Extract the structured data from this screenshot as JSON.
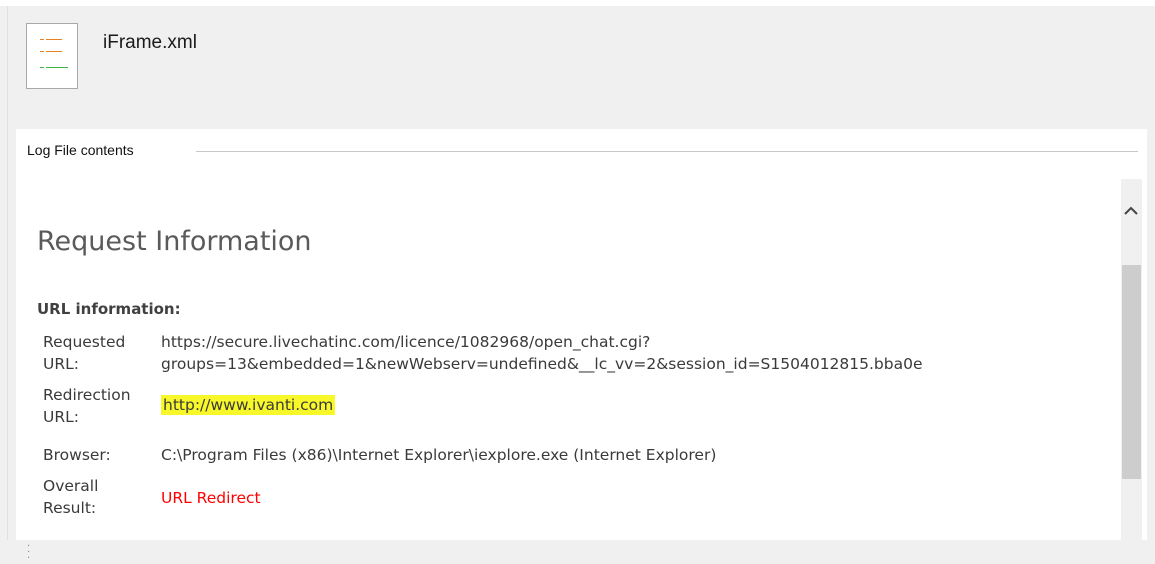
{
  "file": {
    "name": "iFrame.xml",
    "icon": "log-file-icon"
  },
  "panel": {
    "group_label": "Log File contents"
  },
  "request": {
    "title": "Request Information",
    "section_title": "URL information:",
    "rows": [
      {
        "label_line1": "Requested",
        "label_line2": "URL:",
        "value_line1": "https://secure.livechatinc.com/licence/1082968/open_chat.cgi?",
        "value_line2": "groups=13&embedded=1&newWebserv=undefined&__lc_vv=2&session_id=S1504012815.bba0e"
      },
      {
        "label_line1": "Redirection",
        "label_line2": "URL:",
        "value": "http://www.ivanti.com"
      },
      {
        "label": "Browser:",
        "value": "C:\\Program Files (x86)\\Internet Explorer\\iexplore.exe (Internet Explorer)"
      },
      {
        "label_line1": "Overall",
        "label_line2": "Result:",
        "value": "URL Redirect"
      }
    ]
  },
  "colors": {
    "highlight": "#f7f72a",
    "result_red": "#ff0000",
    "icon_lines": [
      "#e8821e",
      "#e8821e",
      "#3cb33c"
    ]
  },
  "scrollbar": {
    "up_arrow": "^"
  }
}
